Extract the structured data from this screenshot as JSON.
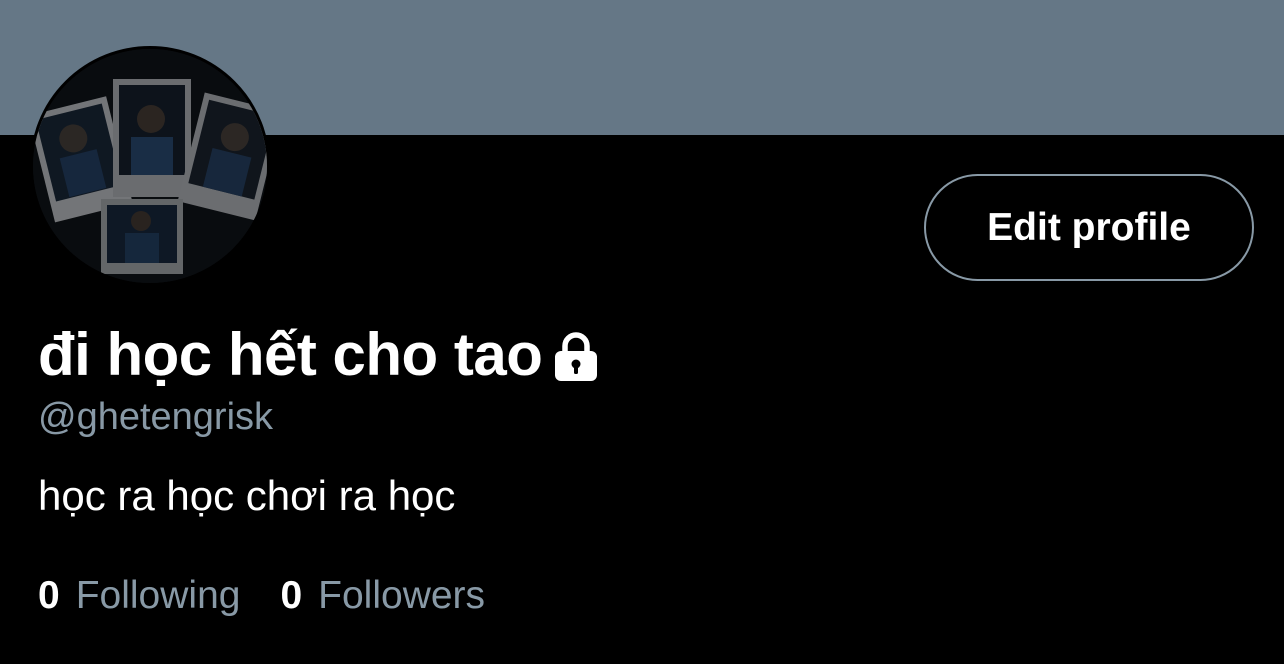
{
  "profile": {
    "display_name": "đi học hết cho tao",
    "handle": "@ghetengrisk",
    "bio": "học ra học chơi ra học",
    "locked_icon": "lock-icon"
  },
  "actions": {
    "edit_profile_label": "Edit profile"
  },
  "stats": {
    "following_count": "0",
    "following_label": "Following",
    "followers_count": "0",
    "followers_label": "Followers"
  },
  "colors": {
    "banner": "#657786",
    "background": "#000000",
    "secondary_text": "#8899a6",
    "primary_text": "#ffffff"
  }
}
